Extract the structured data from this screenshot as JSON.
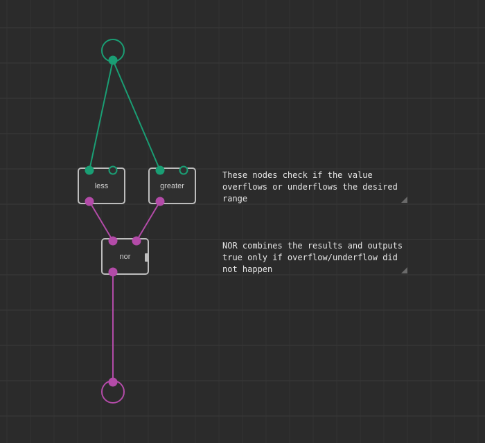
{
  "colors": {
    "background": "#2b2b2b",
    "grid_line": "#333333",
    "boolean_pin": "#1a9e74",
    "number_pin": "#b34ba8",
    "node_border": "#bdbdbd",
    "comment_text": "#e6e6e6"
  },
  "nodes": {
    "less": {
      "label": "less"
    },
    "greater": {
      "label": "greater"
    },
    "nor": {
      "label": "nor"
    }
  },
  "comments": {
    "range_check": "These nodes check if the value overflows or underflows the desired range",
    "nor_explanation": "NOR combines the results and outputs true only if overflow/underflow did not happen"
  }
}
